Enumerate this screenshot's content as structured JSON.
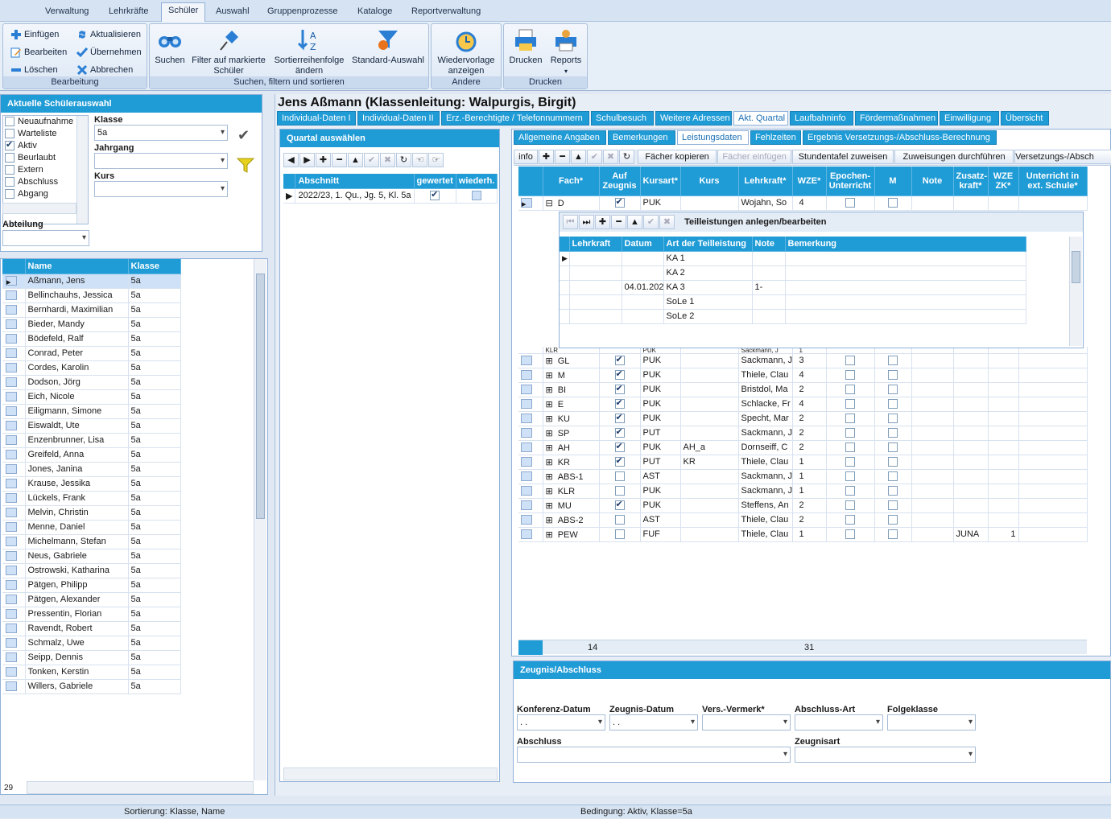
{
  "menu_tabs": [
    "Verwaltung",
    "Lehrkräfte",
    "Schüler",
    "Auswahl",
    "Gruppenprozesse",
    "Kataloge",
    "Reportverwaltung"
  ],
  "ribbon": {
    "bearbeitung": {
      "label": "Bearbeitung",
      "einfuegen": "Einfügen",
      "aktualisieren": "Aktualisieren",
      "bearbeiten": "Bearbeiten",
      "uebernehmen": "Übernehmen",
      "loeschen": "Löschen",
      "abbrechen": "Abbrechen"
    },
    "suchen": {
      "label": "Suchen, filtern und sortieren",
      "suchen": "Suchen",
      "filter": "Filter auf markierte Schüler",
      "sort": "Sortierreihenfolge ändern",
      "standard": "Standard-Auswahl"
    },
    "andere": {
      "label": "Andere",
      "wiedervorlage": "Wiedervorlage anzeigen"
    },
    "drucken": {
      "label": "Drucken",
      "drucken": "Drucken",
      "reports": "Reports"
    }
  },
  "auswahl": {
    "title": "Aktuelle Schülerauswahl",
    "status": [
      {
        "label": "Neuaufnahme",
        "checked": false
      },
      {
        "label": "Warteliste",
        "checked": false
      },
      {
        "label": "Aktiv",
        "checked": true
      },
      {
        "label": "Beurlaubt",
        "checked": false
      },
      {
        "label": "Extern",
        "checked": false
      },
      {
        "label": "Abschluss",
        "checked": false
      },
      {
        "label": "Abgang",
        "checked": false
      }
    ],
    "klasse_label": "Klasse",
    "klasse_value": "5a",
    "jahrgang_label": "Jahrgang",
    "kurs_label": "Kurs",
    "abteilung_label": "Abteilung"
  },
  "schueler": {
    "col_name": "Name",
    "col_klasse": "Klasse",
    "count": "29",
    "rows": [
      [
        "Aßmann, Jens",
        "5a"
      ],
      [
        "Bellinchauhs, Jessica",
        "5a"
      ],
      [
        "Bernhardi, Maximilian",
        "5a"
      ],
      [
        "Bieder, Mandy",
        "5a"
      ],
      [
        "Bödefeld, Ralf",
        "5a"
      ],
      [
        "Conrad, Peter",
        "5a"
      ],
      [
        "Cordes, Karolin",
        "5a"
      ],
      [
        "Dodson, Jörg",
        "5a"
      ],
      [
        "Eich, Nicole",
        "5a"
      ],
      [
        "Eiligmann, Simone",
        "5a"
      ],
      [
        "Eiswaldt, Ute",
        "5a"
      ],
      [
        "Enzenbrunner, Lisa",
        "5a"
      ],
      [
        "Greifeld, Anna",
        "5a"
      ],
      [
        "Jones, Janina",
        "5a"
      ],
      [
        "Krause, Jessika",
        "5a"
      ],
      [
        "Lückels, Frank",
        "5a"
      ],
      [
        "Melvin, Christin",
        "5a"
      ],
      [
        "Menne, Daniel",
        "5a"
      ],
      [
        "Michelmann, Stefan",
        "5a"
      ],
      [
        "Neus, Gabriele",
        "5a"
      ],
      [
        "Ostrowski, Katharina",
        "5a"
      ],
      [
        "Pätgen, Philipp",
        "5a"
      ],
      [
        "Pätgen, Alexander",
        "5a"
      ],
      [
        "Pressentin, Florian",
        "5a"
      ],
      [
        "Ravendt, Robert",
        "5a"
      ],
      [
        "Schmalz, Uwe",
        "5a"
      ],
      [
        "Seipp, Dennis",
        "5a"
      ],
      [
        "Tonken, Kerstin",
        "5a"
      ],
      [
        "Willers, Gabriele",
        "5a"
      ]
    ]
  },
  "student_title": "Jens Aßmann (Klassenleitung: Walpurgis, Birgit)",
  "main_tabs": [
    "Individual-Daten I",
    "Individual-Daten II",
    "Erz.-Berechtigte / Telefonnummern",
    "Schulbesuch",
    "Weitere Adressen",
    "Akt. Quartal",
    "Laufbahninfo",
    "Fördermaßnahmen",
    "Einwilligung",
    "Übersicht"
  ],
  "quartal": {
    "title": "Quartal auswählen",
    "col_abschnitt": "Abschnitt",
    "col_gewertet": "gewertet",
    "col_wiederh": "wiederh.",
    "row": "2022/23, 1. Qu., Jg. 5, Kl. 5a"
  },
  "sub_tabs": [
    "Allgemeine Angaben",
    "Bemerkungen",
    "Leistungsdaten",
    "Fehlzeiten",
    "Ergebnis Versetzungs-/Abschluss-Berechnung"
  ],
  "leist_toolbar": {
    "info": "info",
    "kopieren": "Fächer kopieren",
    "einfuegen": "Fächer einfügen",
    "stundentafel": "Stundentafel zuweisen",
    "zuweisungen": "Zuweisungen durchführen",
    "versetzung": "Versetzungs-/Absch"
  },
  "leist_headers": [
    "Fach*",
    "Auf Zeugnis",
    "Kursart*",
    "Kurs",
    "Lehrkraft*",
    "WZE*",
    "Epochen-Unterricht",
    "M",
    "Note",
    "Zusatz-kraft*",
    "WZE ZK*",
    "Unterricht in ext. Schule*"
  ],
  "first_row": {
    "fach": "D",
    "kursart": "PUK",
    "lehrkraft": "Wojahn, So",
    "wze": "4"
  },
  "teil": {
    "title": "Teilleistungen anlegen/bearbeiten",
    "headers": [
      "Lehrkraft",
      "Datum",
      "Art der Teilleistung",
      "Note",
      "Bemerkung"
    ],
    "rows": [
      [
        "",
        "",
        "KA 1",
        "",
        ""
      ],
      [
        "",
        "",
        "KA 2",
        "",
        ""
      ],
      [
        "",
        "04.01.202",
        "KA 3",
        "1-",
        ""
      ],
      [
        "",
        "",
        "SoLe 1",
        "",
        ""
      ],
      [
        "",
        "",
        "SoLe 2",
        "",
        ""
      ]
    ]
  },
  "partial_row": {
    "fach": "KLR",
    "kursart": "PUK",
    "lehrkraft": "Sackmann, J",
    "wze": "1"
  },
  "leist_rows": [
    {
      "fach": "GL",
      "z": true,
      "ka": "PUK",
      "kurs": "",
      "lk": "Sackmann, J",
      "wze": "3",
      "zk": "",
      "wzezk": ""
    },
    {
      "fach": "M",
      "z": true,
      "ka": "PUK",
      "kurs": "",
      "lk": "Thiele, Clau",
      "wze": "4",
      "zk": "",
      "wzezk": ""
    },
    {
      "fach": "BI",
      "z": true,
      "ka": "PUK",
      "kurs": "",
      "lk": "Bristdol, Ma",
      "wze": "2",
      "zk": "",
      "wzezk": ""
    },
    {
      "fach": "E",
      "z": true,
      "ka": "PUK",
      "kurs": "",
      "lk": "Schlacke, Fr",
      "wze": "4",
      "zk": "",
      "wzezk": ""
    },
    {
      "fach": "KU",
      "z": true,
      "ka": "PUK",
      "kurs": "",
      "lk": "Specht, Mar",
      "wze": "2",
      "zk": "",
      "wzezk": ""
    },
    {
      "fach": "SP",
      "z": true,
      "ka": "PUT",
      "kurs": "",
      "lk": "Sackmann, J",
      "wze": "2",
      "zk": "",
      "wzezk": ""
    },
    {
      "fach": "AH",
      "z": true,
      "ka": "PUK",
      "kurs": "AH_a",
      "lk": "Dornseiff, C",
      "wze": "2",
      "zk": "",
      "wzezk": ""
    },
    {
      "fach": "KR",
      "z": true,
      "ka": "PUT",
      "kurs": "KR",
      "lk": "Thiele, Clau",
      "wze": "1",
      "zk": "",
      "wzezk": ""
    },
    {
      "fach": "ABS-1",
      "z": false,
      "ka": "AST",
      "kurs": "",
      "lk": "Sackmann, J",
      "wze": "1",
      "zk": "",
      "wzezk": ""
    },
    {
      "fach": "KLR",
      "z": false,
      "ka": "PUK",
      "kurs": "",
      "lk": "Sackmann, J",
      "wze": "1",
      "zk": "",
      "wzezk": ""
    },
    {
      "fach": "MU",
      "z": true,
      "ka": "PUK",
      "kurs": "",
      "lk": "Steffens, An",
      "wze": "2",
      "zk": "",
      "wzezk": ""
    },
    {
      "fach": "ABS-2",
      "z": false,
      "ka": "AST",
      "kurs": "",
      "lk": "Thiele, Clau",
      "wze": "2",
      "zk": "",
      "wzezk": ""
    },
    {
      "fach": "PEW",
      "z": false,
      "ka": "FUF",
      "kurs": "",
      "lk": "Thiele, Clau",
      "wze": "1",
      "zk": "JUNA",
      "wzezk": "1"
    }
  ],
  "leist_footer": {
    "count": "14",
    "sum": "31"
  },
  "zeugnis": {
    "title": "Zeugnis/Abschluss",
    "konferenz": "Konferenz-Datum",
    "konferenz_val": ". .",
    "zeugnisdatum": "Zeugnis-Datum",
    "zeugnisdatum_val": ". .",
    "vers": "Vers.-Vermerk*",
    "abschlussart": "Abschluss-Art",
    "folgeklasse": "Folgeklasse",
    "abschluss": "Abschluss",
    "zeugnisart": "Zeugnisart"
  },
  "status": {
    "sortierung": "Sortierung: Klasse, Name",
    "bedingung": "Bedingung: Aktiv, Klasse=5a"
  }
}
